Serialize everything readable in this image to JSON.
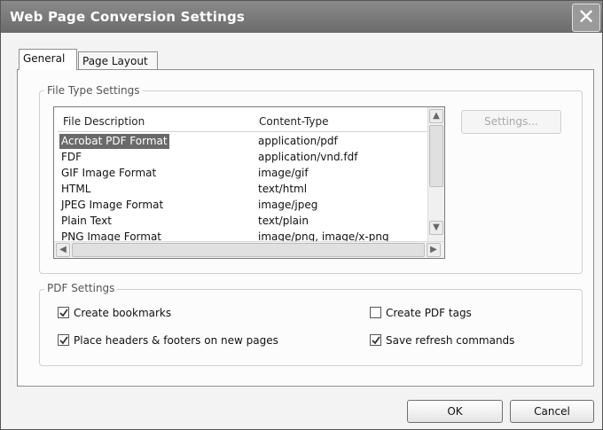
{
  "window": {
    "title": "Web Page Conversion Settings",
    "close_glyph": "✕"
  },
  "tabs": [
    {
      "label": "General",
      "active": true
    },
    {
      "label": "Page Layout",
      "active": false
    }
  ],
  "file_type_settings": {
    "legend": "File Type Settings",
    "columns": [
      "File Description",
      "Content-Type"
    ],
    "rows": [
      {
        "desc": "Acrobat PDF Format",
        "type": "application/pdf",
        "selected": true
      },
      {
        "desc": "FDF",
        "type": "application/vnd.fdf"
      },
      {
        "desc": "GIF Image Format",
        "type": "image/gif"
      },
      {
        "desc": "HTML",
        "type": "text/html"
      },
      {
        "desc": "JPEG Image Format",
        "type": "image/jpeg"
      },
      {
        "desc": "Plain Text",
        "type": "text/plain"
      },
      {
        "desc": "PNG Image Format",
        "type": "image/png, image/x-png"
      }
    ],
    "settings_button": "Settings..."
  },
  "pdf_settings": {
    "legend": "PDF Settings",
    "options": [
      {
        "label": "Create bookmarks",
        "checked": true
      },
      {
        "label": "Create PDF tags",
        "checked": false
      },
      {
        "label": "Place headers & footers on new pages",
        "checked": true
      },
      {
        "label": "Save refresh commands",
        "checked": true
      }
    ]
  },
  "footer": {
    "ok": "OK",
    "cancel": "Cancel"
  }
}
